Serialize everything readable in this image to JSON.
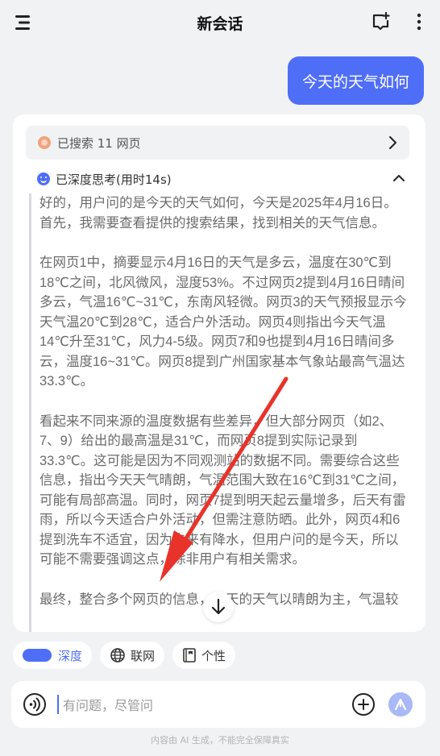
{
  "header": {
    "title": "新会话",
    "menu_icon": "menu-icon",
    "new_chat_icon": "new-chat-icon",
    "more_icon": "more-vertical-icon"
  },
  "conversation": {
    "user_message": "今天的天气如何",
    "answer": {
      "search_summary": "已搜索 11 网页",
      "thinking_header": "已深度思考(用时14s)",
      "thinking_paragraphs": [
        "好的，用户问的是今天的天气如何，今天是2025年4月16日。首先，我需要查看提供的搜索结果，找到相关的天气信息。",
        "在网页1中，摘要显示4月16日的天气是多云，温度在30℃到18℃之间，北风微风，湿度53%。不过网页2提到4月16日晴间多云，气温16℃~31℃，东南风轻微。网页3的天气预报显示今天气温20℃到28℃，适合户外活动。网页4则指出今天气温14℃升至31℃，风力4-5级。网页7和9也提到4月16日晴间多云，温度16~31℃。网页8提到广州国家基本气象站最高气温达33.3℃。",
        "看起来不同来源的温度数据有些差异，但大部分网页（如2、7、9）给出的最高温是31℃，而网页8提到实际记录到33.3℃。这可能是因为不同观测站的数据不同。需要综合这些信息，指出今天天气晴朗，气温范围大致在16℃到31℃之间，可能有局部高温。同时，网页7提到明天起云量增多，后天有雷雨，所以今天适合户外活动，但需注意防晒。此外，网页4和6提到洗车不适宜，因为未来有降水，但用户问的是今天，所以可能不需要强调这点，除非用户有相关需求。",
        "最终，整合多个网页的信息，今天的天气以晴朗为主，气温较"
      ]
    }
  },
  "toolbar": {
    "chips": [
      {
        "label": "深度",
        "active": true,
        "icon": "toggle-pill-icon"
      },
      {
        "label": "联网",
        "active": false,
        "icon": "globe-icon"
      },
      {
        "label": "个性",
        "active": false,
        "icon": "book-icon"
      }
    ]
  },
  "composer": {
    "placeholder": "有问题，尽管问",
    "voice_icon": "voice-icon",
    "add_icon": "plus-icon",
    "send_icon": "send-icon"
  },
  "footer": {
    "disclaimer": "内容由 AI 生成，不能完全保障真实"
  },
  "colors": {
    "accent": "#4f6ef7",
    "annotation_arrow": "#e8332a",
    "background": "#f1f2f4"
  }
}
